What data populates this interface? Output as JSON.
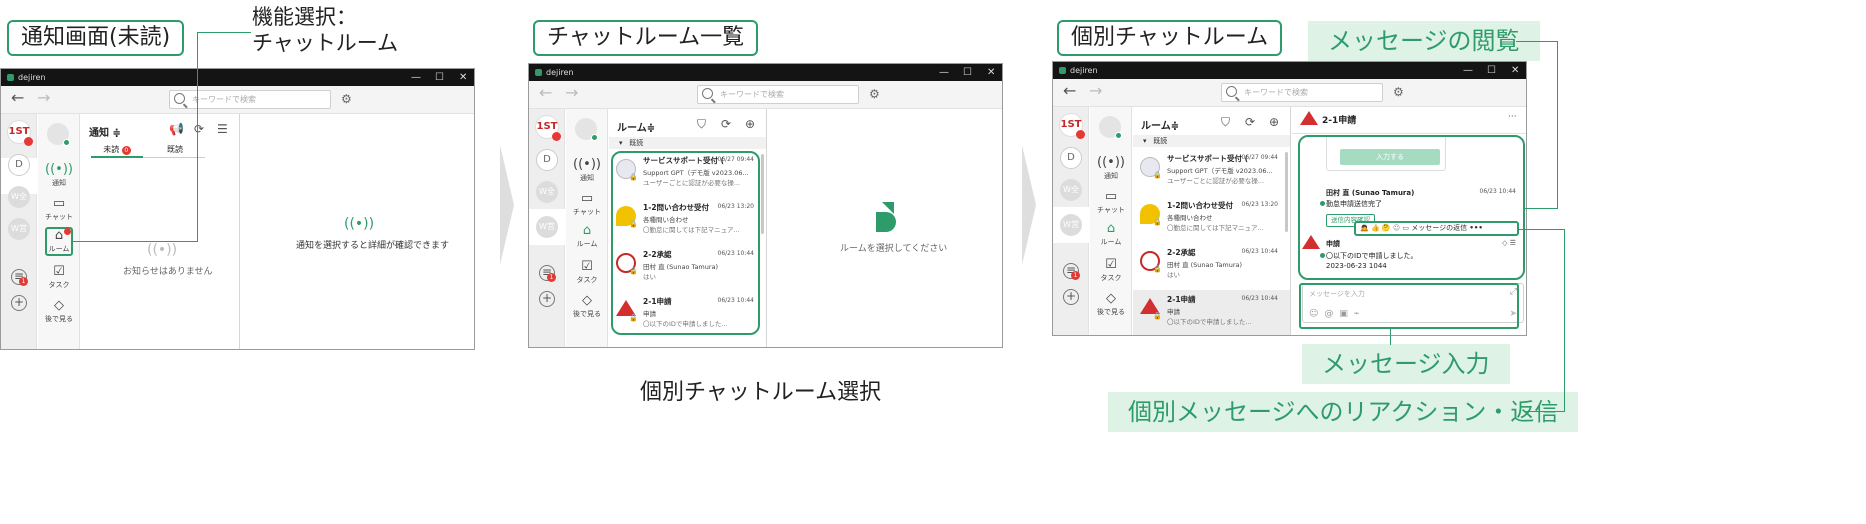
{
  "labels": {
    "panel1_caption": "通知画面(未読)",
    "panel2_caption": "チャットルーム一覧",
    "panel3_caption": "個別チャットルーム",
    "annotation_select_line1": "機能選択：",
    "annotation_select_line2": "チャットルーム",
    "bottom_caption": "個別チャットルーム選択",
    "message_view": "メッセージの閲覧",
    "message_input": "メッセージ入力",
    "reaction_reply": "個別メッセージへのリアクション・返信"
  },
  "app": {
    "name": "dejiren",
    "search_placeholder": "キーワードで検索",
    "min": "—",
    "max": "☐",
    "close": "✕",
    "back": "←",
    "forward": "→"
  },
  "rail": {
    "logo": "1ST",
    "items": [
      "D",
      "W全",
      "W営"
    ],
    "add": "+"
  },
  "nav": {
    "notify": "通知",
    "chat": "チャット",
    "room": "ルーム",
    "task": "タスク",
    "later": "後で見る"
  },
  "notify_screen": {
    "header": "通知 ≑",
    "tab_unread": "未読",
    "tab_unread_badge": "0",
    "tab_read": "既読",
    "empty": "お知らせはありません",
    "detail_hint": "通知を選択すると詳細が確認できます"
  },
  "room_list": {
    "header": "ルーム≑",
    "section": "既読",
    "empty_hint": "ルームを選択してください",
    "rooms": [
      {
        "name": "サービスサポート受付 (",
        "time": "06/27 09:44",
        "sub": "Support GPT（デモ版 v2023.06...",
        "preview": "ユーザーごとに認証が必要な操..."
      },
      {
        "name": "1-2問い合わせ受付",
        "time": "06/23 13:20",
        "sub": "各種問い合わせ",
        "preview": "〇勤怠に関しては下記マニュア..."
      },
      {
        "name": "2-2承認",
        "time": "06/23 10:44",
        "sub": "田村 直 (Sunao Tamura)",
        "preview": "はい"
      },
      {
        "name": "2-1申請",
        "time": "06/23 10:44",
        "sub": "申請",
        "preview": "〇以下のIDで申請しました..."
      }
    ]
  },
  "chat_room": {
    "title": "2-1申請",
    "more": "···",
    "input_button": "入力する",
    "msg1_author": "田村 直 (Sunao Tamura)",
    "msg1_time": "06/23 10:44",
    "msg1_text": "勤怠申請送信完了",
    "msg1_button": "送信内容確認",
    "reply_label": "メッセージの返信",
    "msg2_author": "申請",
    "msg2_text": "〇以下のIDで申請しました。",
    "msg2_sub": "2023-06-23 1044",
    "input_placeholder": "メッセージを入力"
  }
}
